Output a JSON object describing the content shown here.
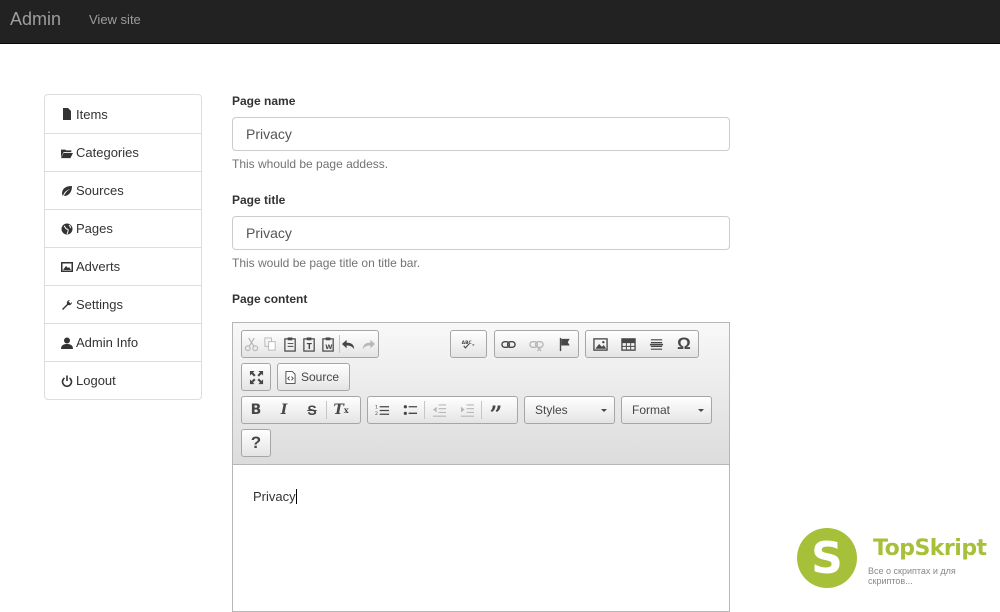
{
  "navbar": {
    "brand": "Admin",
    "link": "View site"
  },
  "sidebar": {
    "items": [
      {
        "label": "Items",
        "icon": "file-icon"
      },
      {
        "label": "Categories",
        "icon": "folder-open-icon"
      },
      {
        "label": "Sources",
        "icon": "leaf-icon"
      },
      {
        "label": "Pages",
        "icon": "globe-icon"
      },
      {
        "label": "Adverts",
        "icon": "picture-icon"
      },
      {
        "label": "Settings",
        "icon": "wrench-icon"
      },
      {
        "label": "Admin Info",
        "icon": "user-icon"
      },
      {
        "label": "Logout",
        "icon": "power-icon"
      }
    ]
  },
  "form": {
    "page_name": {
      "label": "Page name",
      "value": "Privacy",
      "help": "This whould be page addess."
    },
    "page_title": {
      "label": "Page title",
      "value": "Privacy",
      "help": "This would be page title on title bar."
    },
    "page_content": {
      "label": "Page content"
    }
  },
  "editor": {
    "source_label": "Source",
    "styles_label": "Styles",
    "format_label": "Format",
    "help_label": "?",
    "content": "Privacy"
  },
  "watermark": {
    "logo_letter": "S",
    "title": "TopSkript",
    "subtitle": "Все о скриптах и для скриптов..."
  },
  "colors": {
    "navbar": "#222222",
    "accent": "#a6c03a"
  }
}
